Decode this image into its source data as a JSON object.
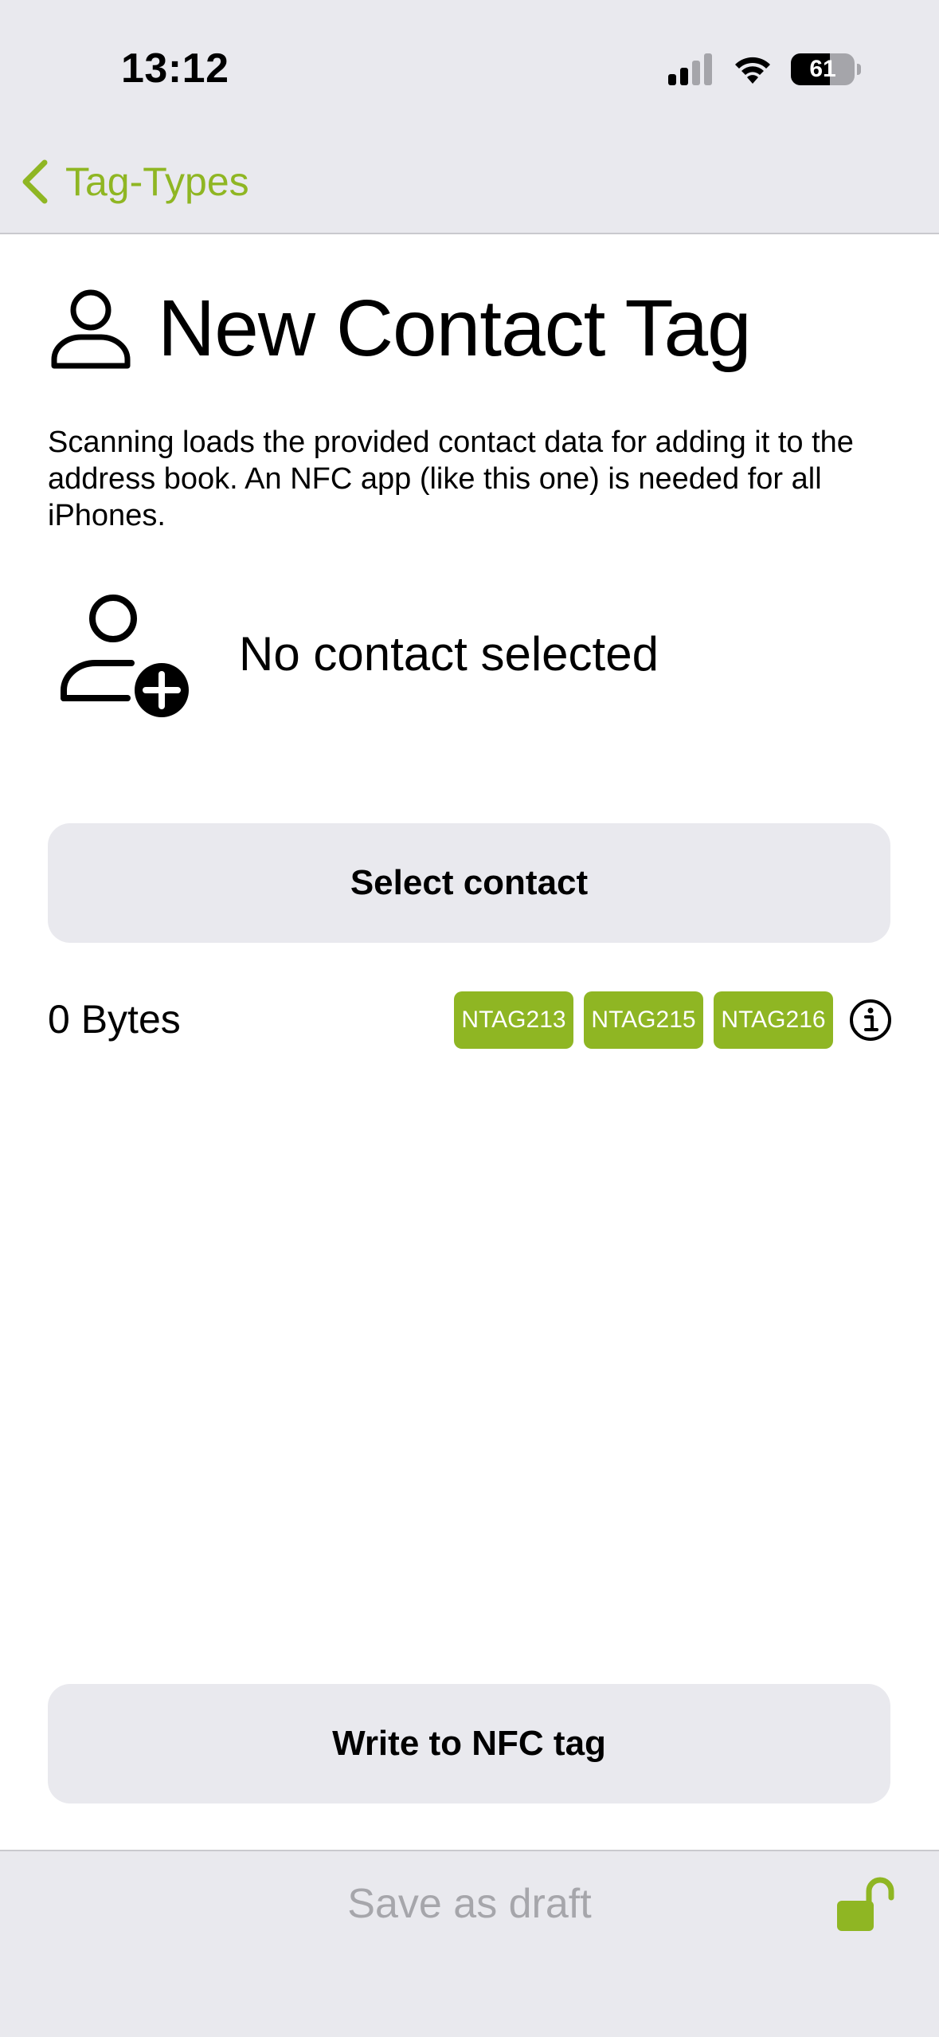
{
  "status_bar": {
    "time": "13:12",
    "battery_percent": "61",
    "battery_level": 0.61,
    "signal_icon": "cellular-signal-icon",
    "wifi_icon": "wifi-icon"
  },
  "nav": {
    "back_label": "Tag-Types",
    "back_icon": "chevron-left-icon"
  },
  "page": {
    "title": "New Contact Tag",
    "title_icon": "person-icon",
    "description": "Scanning loads the provided contact data for adding it to the address book. An NFC app (like this one) is needed for all iPhones."
  },
  "contact": {
    "icon": "person-add-icon",
    "status": "No contact selected",
    "select_label": "Select contact"
  },
  "capacity": {
    "bytes_label": "0 Bytes",
    "tags": [
      "NTAG213",
      "NTAG215",
      "NTAG216"
    ],
    "info_icon": "info-circle-icon"
  },
  "actions": {
    "write_label": "Write to NFC tag",
    "save_draft_label": "Save as draft",
    "lock_icon": "unlock-icon"
  },
  "colors": {
    "accent": "#8fb623",
    "bar_background": "#e9e9ee",
    "disabled_text": "#a6a6ab"
  }
}
